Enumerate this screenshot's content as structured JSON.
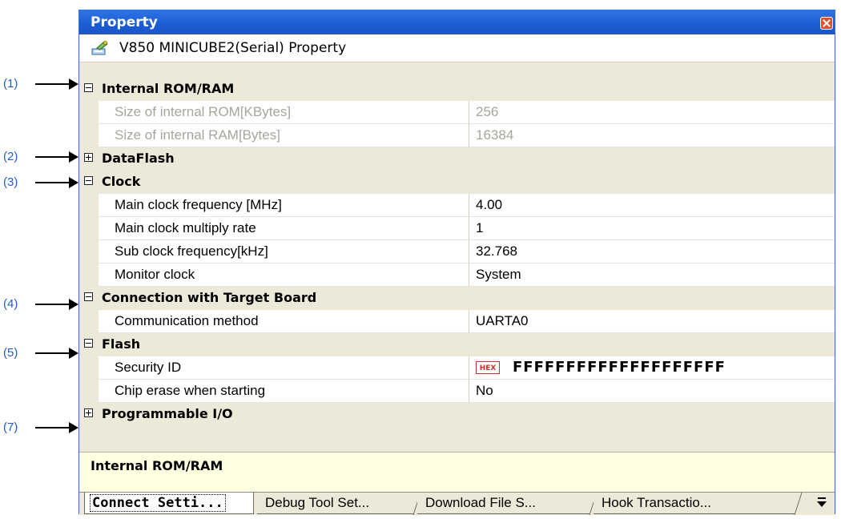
{
  "window": {
    "title": "Property",
    "object_label": "V850 MINICUBE2(Serial) Property"
  },
  "callouts": [
    "(1)",
    "(2)",
    "(3)",
    "(4)",
    "(5)",
    "(7)"
  ],
  "grid": {
    "internal_rom_ram": {
      "label": "Internal ROM/RAM",
      "rom_size": {
        "name": "Size of internal ROM[KBytes]",
        "value": "256"
      },
      "ram_size": {
        "name": "Size of internal RAM[Bytes]",
        "value": "16384"
      }
    },
    "dataflash": {
      "label": "DataFlash"
    },
    "clock": {
      "label": "Clock",
      "main_freq": {
        "name": "Main clock frequency [MHz]",
        "value": "4.00"
      },
      "multiply_rate": {
        "name": "Main clock multiply rate",
        "value": "1"
      },
      "sub_freq": {
        "name": "Sub clock frequency[kHz]",
        "value": "32.768"
      },
      "monitor_clock": {
        "name": "Monitor clock",
        "value": "System"
      }
    },
    "connection": {
      "label": "Connection with Target Board",
      "comm_method": {
        "name": "Communication method",
        "value": "UARTA0"
      }
    },
    "flash": {
      "label": "Flash",
      "security_id": {
        "name": "Security ID",
        "badge": "HEX",
        "value": "FFFFFFFFFFFFFFFFFFFF"
      },
      "chip_erase": {
        "name": "Chip erase when starting",
        "value": "No"
      }
    },
    "programmable_io": {
      "label": "Programmable I/O"
    }
  },
  "description": {
    "text": "Internal ROM/RAM"
  },
  "tabs": [
    {
      "label": "Connect Setti...",
      "active": true
    },
    {
      "label": "Debug Tool Set..."
    },
    {
      "label": "Download File S..."
    },
    {
      "label": "Hook Transactio..."
    }
  ],
  "colors": {
    "titlebar": "#1c5cd2",
    "panel": "#ece9d8",
    "description_bg": "#ffffe1",
    "callout_text": "#1f5fbf",
    "hex_badge": "#c8322a"
  }
}
